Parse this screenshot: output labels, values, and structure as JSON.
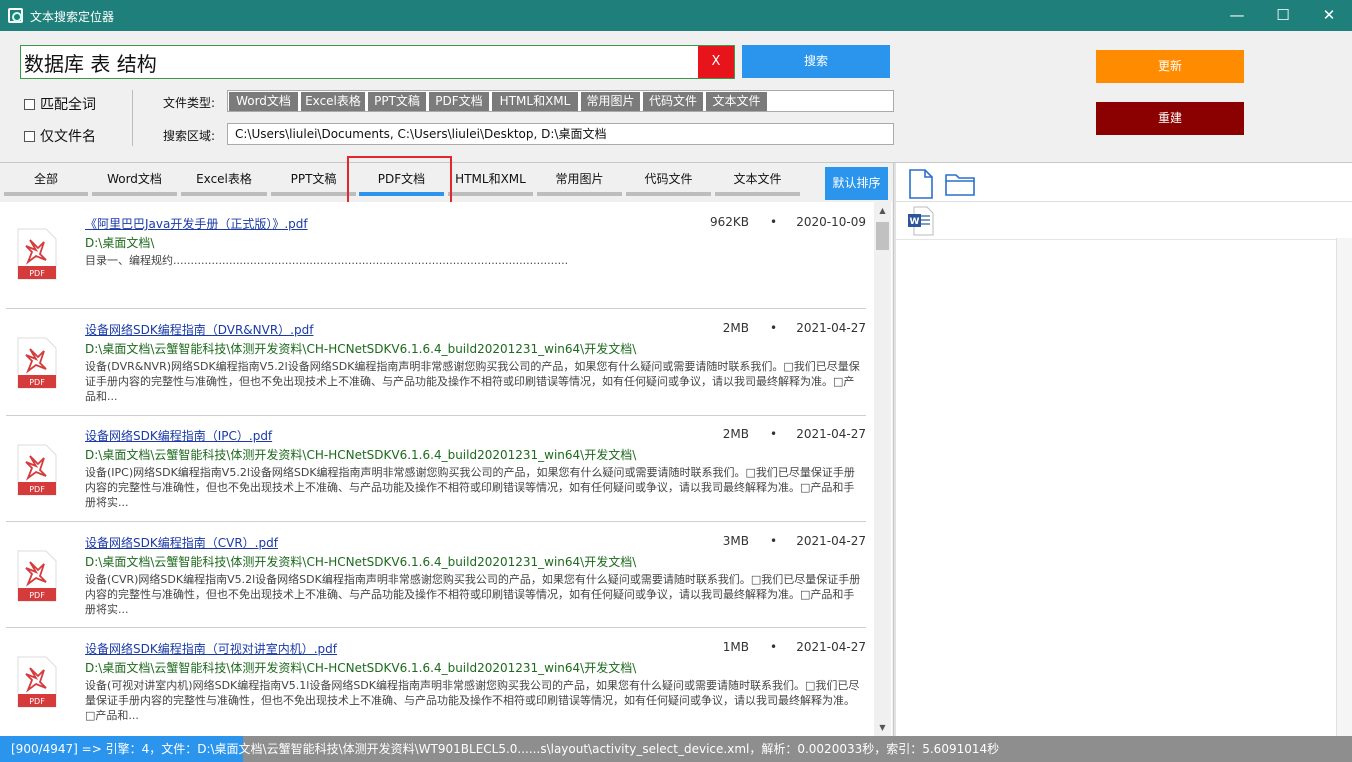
{
  "window": {
    "title": "文本搜索定位器",
    "minimize": "—",
    "maximize": "☐",
    "close": "✕"
  },
  "search": {
    "value": "数据库 表 结构",
    "clear_label": "X",
    "search_label": "搜索"
  },
  "actions": {
    "update_label": "更新",
    "rebuild_label": "重建"
  },
  "options": {
    "match_whole_word": "匹配全词",
    "filename_only": "仅文件名"
  },
  "file_types": {
    "label": "文件类型:",
    "tags": [
      "Word文档",
      "Excel表格",
      "PPT文稿",
      "PDF文档",
      "HTML和XML",
      "常用图片",
      "代码文件",
      "文本文件"
    ]
  },
  "search_area": {
    "label": "搜索区域:",
    "value": "C:\\Users\\liulei\\Documents, C:\\Users\\liulei\\Desktop, D:\\桌面文档"
  },
  "tabs": [
    {
      "label": "全部"
    },
    {
      "label": "Word文档"
    },
    {
      "label": "Excel表格"
    },
    {
      "label": "PPT文稿"
    },
    {
      "label": "PDF文档",
      "active": true
    },
    {
      "label": "HTML和XML"
    },
    {
      "label": "常用图片"
    },
    {
      "label": "代码文件"
    },
    {
      "label": "文本文件"
    }
  ],
  "sort_label": "默认排序",
  "pdf_icon_text": "PDF",
  "results": [
    {
      "name": "《阿里巴巴Java开发手册（正式版）》.pdf",
      "path": "D:\\桌面文档\\",
      "snippet": "目录一、编程规约.................................................................................................................",
      "size": "962KB",
      "dot": "•",
      "date": "2020-10-09"
    },
    {
      "name": "设备网络SDK编程指南（DVR&NVR）.pdf",
      "path": "D:\\桌面文档\\云蟹智能科技\\体测开发资料\\CH-HCNetSDKV6.1.6.4_build20201231_win64\\开发文档\\",
      "snippet": "设备(DVR&NVR)网络SDK编程指南V5.2l设备网络SDK编程指南声明非常感谢您购买我公司的产品，如果您有什么疑问或需要请随时联系我们。□我们已尽量保证手册内容的完整性与准确性，但也不免出现技术上不准确、与产品功能及操作不相符或印刷错误等情况，如有任何疑问或争议，请以我司最终解释为准。□产品和...",
      "size": "2MB",
      "dot": "•",
      "date": "2021-04-27"
    },
    {
      "name": "设备网络SDK编程指南（IPC）.pdf",
      "path": "D:\\桌面文档\\云蟹智能科技\\体测开发资料\\CH-HCNetSDKV6.1.6.4_build20201231_win64\\开发文档\\",
      "snippet": "设备(IPC)网络SDK编程指南V5.2l设备网络SDK编程指南声明非常感谢您购买我公司的产品，如果您有什么疑问或需要请随时联系我们。□我们已尽量保证手册内容的完整性与准确性，但也不免出现技术上不准确、与产品功能及操作不相符或印刷错误等情况，如有任何疑问或争议，请以我司最终解释为准。□产品和手册将实...",
      "size": "2MB",
      "dot": "•",
      "date": "2021-04-27"
    },
    {
      "name": "设备网络SDK编程指南（CVR）.pdf",
      "path": "D:\\桌面文档\\云蟹智能科技\\体测开发资料\\CH-HCNetSDKV6.1.6.4_build20201231_win64\\开发文档\\",
      "snippet": "设备(CVR)网络SDK编程指南V5.2l设备网络SDK编程指南声明非常感谢您购买我公司的产品，如果您有什么疑问或需要请随时联系我们。□我们已尽量保证手册内容的完整性与准确性，但也不免出现技术上不准确、与产品功能及操作不相符或印刷错误等情况，如有任何疑问或争议，请以我司最终解释为准。□产品和手册将实...",
      "size": "3MB",
      "dot": "•",
      "date": "2021-04-27"
    },
    {
      "name": "设备网络SDK编程指南（可视对讲室内机）.pdf",
      "path": "D:\\桌面文档\\云蟹智能科技\\体测开发资料\\CH-HCNetSDKV6.1.6.4_build20201231_win64\\开发文档\\",
      "snippet": "设备(可视对讲室内机)网络SDK编程指南V5.1l设备网络SDK编程指南声明非常感谢您购买我公司的产品，如果您有什么疑问或需要请随时联系我们。□我们已尽量保证手册内容的完整性与准确性，但也不免出现技术上不准确、与产品功能及操作不相符或印刷错误等情况，如有任何疑问或争议，请以我司最终解释为准。□产品和...",
      "size": "1MB",
      "dot": "•",
      "date": "2021-04-27"
    }
  ],
  "preview": {
    "word_icon_letter": "W"
  },
  "status": {
    "text": "[900/4947] => 引擎：4，文件：D:\\桌面文档\\云蟹智能科技\\体测开发资料\\WT901BLECL5.0......s\\layout\\activity_select_device.xml，解析：0.0020033秒，索引：5.6091014秒",
    "progress": 0.18
  }
}
